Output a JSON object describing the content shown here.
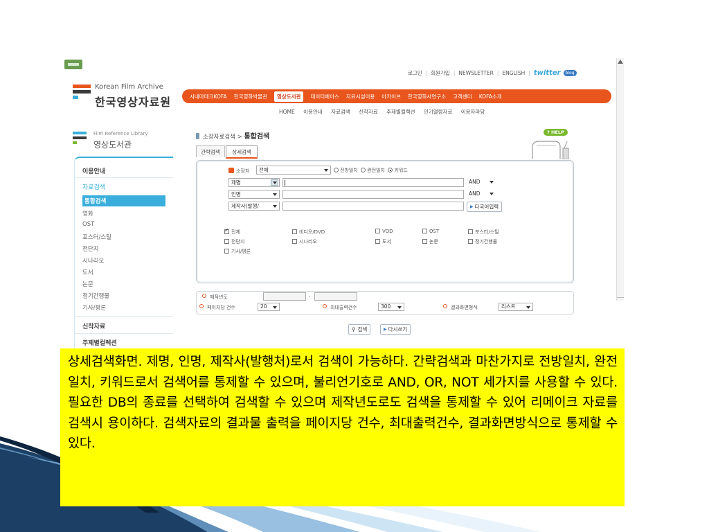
{
  "utility_nav": {
    "links": [
      "로그인",
      "회원가입",
      "NEWSLETTER",
      "ENGLISH"
    ],
    "twitter_label": "twitter",
    "blog_label": "blog"
  },
  "logo": {
    "english": "Korean Film Archive",
    "korean": "한국영상자료원"
  },
  "main_nav": [
    "시네마테크KOFA",
    "한국영화박물관",
    "영상도서관",
    "데이터베이스",
    "자료시설이용",
    "아카이브",
    "한국영화사연구소",
    "고객센터",
    "KOFA소개"
  ],
  "main_nav_active": "영상도서관",
  "sub_nav": [
    "HOME",
    "이용안내",
    "자료검색",
    "신착자료",
    "주제별컬렉션",
    "인기열람자료",
    "이용자마당"
  ],
  "library": {
    "english": "Film Reference Library",
    "korean": "영상도서관"
  },
  "sidebar": {
    "usage": "이용안내",
    "search_category": "자료검색",
    "active": "통합검색",
    "items": [
      "영화",
      "OST",
      "포스터/스틸",
      "전단지",
      "시나리오",
      "도서",
      "논문",
      "정기간행물",
      "기사/평론"
    ],
    "new_arrivals": "신착자료",
    "collections": "주제별컬렉션"
  },
  "breadcrumb": {
    "parent": "소장자료검색 >",
    "current": "통합검색"
  },
  "help_label": "HELP",
  "tabs": {
    "simple": "간략검색",
    "detailed": "상세검색"
  },
  "search_form": {
    "holdings_label": "소장처",
    "holdings_value": "전체",
    "match_options": [
      "전방일치",
      "완전일치",
      "키워드"
    ],
    "fields": [
      "제명",
      "인명",
      "제작사(발행/"
    ],
    "operators": [
      "AND",
      "AND"
    ],
    "multilang_button": "다국어입력",
    "types": [
      "전체",
      "비디오/DVD",
      "VOD",
      "OST",
      "포스터/스틸",
      "전단지",
      "시나리오",
      "도서",
      "논문",
      "정기간행물",
      "기사/평론"
    ]
  },
  "options": {
    "year_label": "제작년도",
    "year_separator": "-",
    "per_page_label": "페이지당 건수",
    "per_page_value": "20",
    "max_label": "최대출력건수",
    "max_value": "300",
    "display_label": "결과화면형식",
    "display_value": "리스트"
  },
  "buttons": {
    "search": "검색",
    "reset": "다시쓰기"
  },
  "description": "상세검색화면. 제명, 인명, 제작사(발행처)로서 검색이 가능하다. 간략검색과 마찬가지로 전방일치, 완전일치, 키워드로서 검색어를 통제할 수 있으며, 불리언기호로 AND, OR, NOT 세가지를 사용할 수 있다. 필요한 DB의 종료를 선택하여 검색할 수 있으며 제작년도로도 검색을 통제할 수 있어 리메이크 자료를 검색시 용이하다. 검색자료의 결과물 출력을 페이지당 건수, 최대출력건수, 결과화면방식으로 통제할 수 있다.",
  "colors": {
    "nav_orange": "#e8551d",
    "accent_blue": "#3aaedc",
    "highlight_yellow": "#ffff00",
    "swoosh_navy": "#1c3f66"
  }
}
